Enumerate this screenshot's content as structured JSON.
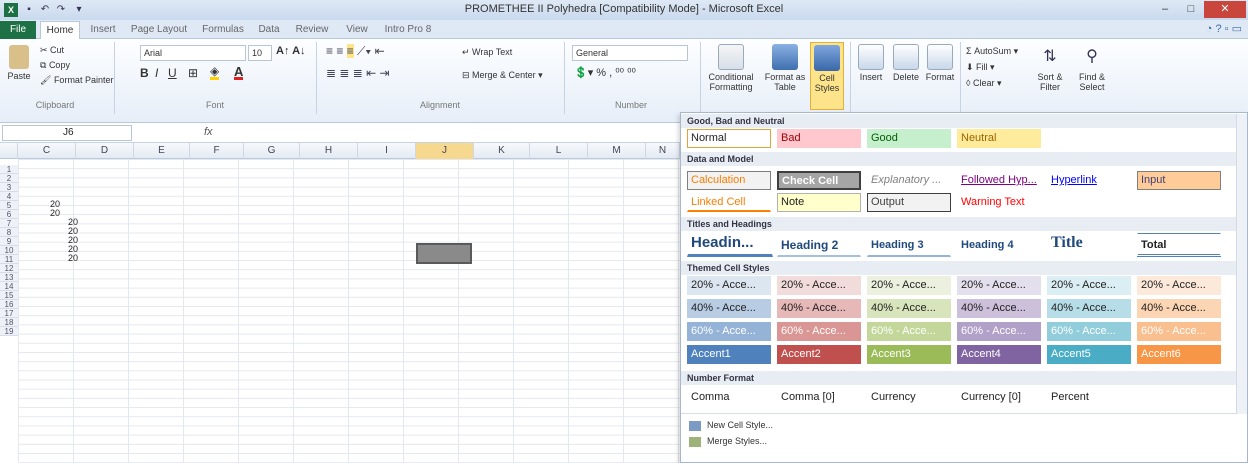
{
  "window": {
    "title": "PROMETHEE II Polyhedra [Compatibility Mode] - Microsoft Excel",
    "min": "–",
    "max": "□",
    "close": "✕"
  },
  "tabs": {
    "file": "File",
    "items": [
      "Home",
      "Insert",
      "Page Layout",
      "Formulas",
      "Data",
      "Review",
      "View",
      "Intro Pro 8"
    ]
  },
  "ribbon": {
    "clipboard": {
      "paste": "Paste",
      "cut": "Cut",
      "copy": "Copy",
      "format_painter": "Format Painter",
      "group": "Clipboard"
    },
    "font": {
      "name": "Arial",
      "size": "10",
      "group": "Font"
    },
    "alignment": {
      "wrap": "Wrap Text",
      "merge": "Merge & Center",
      "group": "Alignment"
    },
    "number": {
      "format": "General",
      "group": "Number"
    },
    "styles": {
      "conditional": "Conditional Formatting",
      "format_table": "Format as Table",
      "cell_styles": "Cell Styles"
    },
    "cells": {
      "insert": "Insert",
      "delete": "Delete",
      "format": "Format"
    },
    "editing": {
      "autosum": "AutoSum",
      "fill": "Fill",
      "clear": "Clear",
      "sort": "Sort & Filter",
      "find": "Find & Select"
    }
  },
  "formula_bar": {
    "name_box": "J6",
    "fx": "fx"
  },
  "columns": [
    "C",
    "D",
    "E",
    "F",
    "G",
    "H",
    "I",
    "J",
    "K",
    "L",
    "M",
    "N"
  ],
  "rows": [
    "1",
    "2",
    "3",
    "4",
    "5",
    "6",
    "7",
    "8",
    "9",
    "10",
    "11",
    "12",
    "13",
    "14",
    "15",
    "16",
    "17",
    "18",
    "19"
  ],
  "cells": {
    "c3": "20",
    "c4": "20",
    "d5": "20",
    "d6": "20",
    "d7": "20",
    "d8": "20",
    "d9": "20"
  },
  "gallery": {
    "sections": {
      "good_bad": "Good, Bad and Neutral",
      "data_model": "Data and Model",
      "titles": "Titles and Headings",
      "themed": "Themed Cell Styles",
      "number": "Number Format"
    },
    "good_bad": [
      "Normal",
      "Bad",
      "Good",
      "Neutral"
    ],
    "data_model_1": [
      "Calculation",
      "Check Cell",
      "Explanatory ...",
      "Followed Hyp...",
      "Hyperlink",
      "Input"
    ],
    "data_model_2": [
      "Linked Cell",
      "Note",
      "Output",
      "Warning Text"
    ],
    "titles": [
      "Headin...",
      "Heading 2",
      "Heading 3",
      "Heading 4",
      "Title",
      "Total"
    ],
    "themed_20": [
      "20% - Acce...",
      "20% - Acce...",
      "20% - Acce...",
      "20% - Acce...",
      "20% - Acce...",
      "20% - Acce..."
    ],
    "themed_40": [
      "40% - Acce...",
      "40% - Acce...",
      "40% - Acce...",
      "40% - Acce...",
      "40% - Acce...",
      "40% - Acce..."
    ],
    "themed_60": [
      "60% - Acce...",
      "60% - Acce...",
      "60% - Acce...",
      "60% - Acce...",
      "60% - Acce...",
      "60% - Acce..."
    ],
    "accents": [
      "Accent1",
      "Accent2",
      "Accent3",
      "Accent4",
      "Accent5",
      "Accent6"
    ],
    "number": [
      "Comma",
      "Comma [0]",
      "Currency",
      "Currency [0]",
      "Percent"
    ],
    "new_style": "New Cell Style...",
    "merge_styles": "Merge Styles..."
  }
}
